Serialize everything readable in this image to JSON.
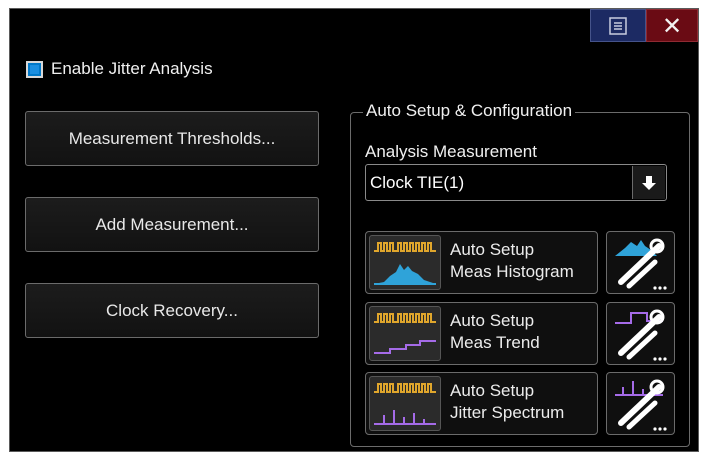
{
  "dialog": {
    "menu_icon": "list-menu-icon",
    "close_icon": "close-x-icon",
    "close_glyph": "✕"
  },
  "jitter": {
    "enable_label": "Enable Jitter Analysis",
    "enabled": true
  },
  "buttons": {
    "thresholds": "Measurement Thresholds...",
    "add_measurement": "Add Measurement...",
    "clock_recovery": "Clock Recovery..."
  },
  "auto_setup": {
    "group_title": "Auto Setup & Configuration",
    "analysis_label": "Analysis Measurement",
    "analysis_value": "Clock TIE(1)",
    "dropdown_icon": "arrow-down-icon",
    "items": [
      {
        "line1": "Auto Setup",
        "line2": "Meas Histogram",
        "icon": "histogram-waveform-icon",
        "tool_icon": "histogram-config-tools-icon",
        "color": "#2fa3d9"
      },
      {
        "line1": "Auto Setup",
        "line2": "Meas Trend",
        "icon": "trend-waveform-icon",
        "tool_icon": "trend-config-tools-icon",
        "color": "#a56be8"
      },
      {
        "line1": "Auto Setup",
        "line2": "Jitter Spectrum",
        "icon": "spectrum-waveform-icon",
        "tool_icon": "spectrum-config-tools-icon",
        "color": "#a56be8"
      }
    ],
    "pulse_color": "#e0a62c"
  }
}
